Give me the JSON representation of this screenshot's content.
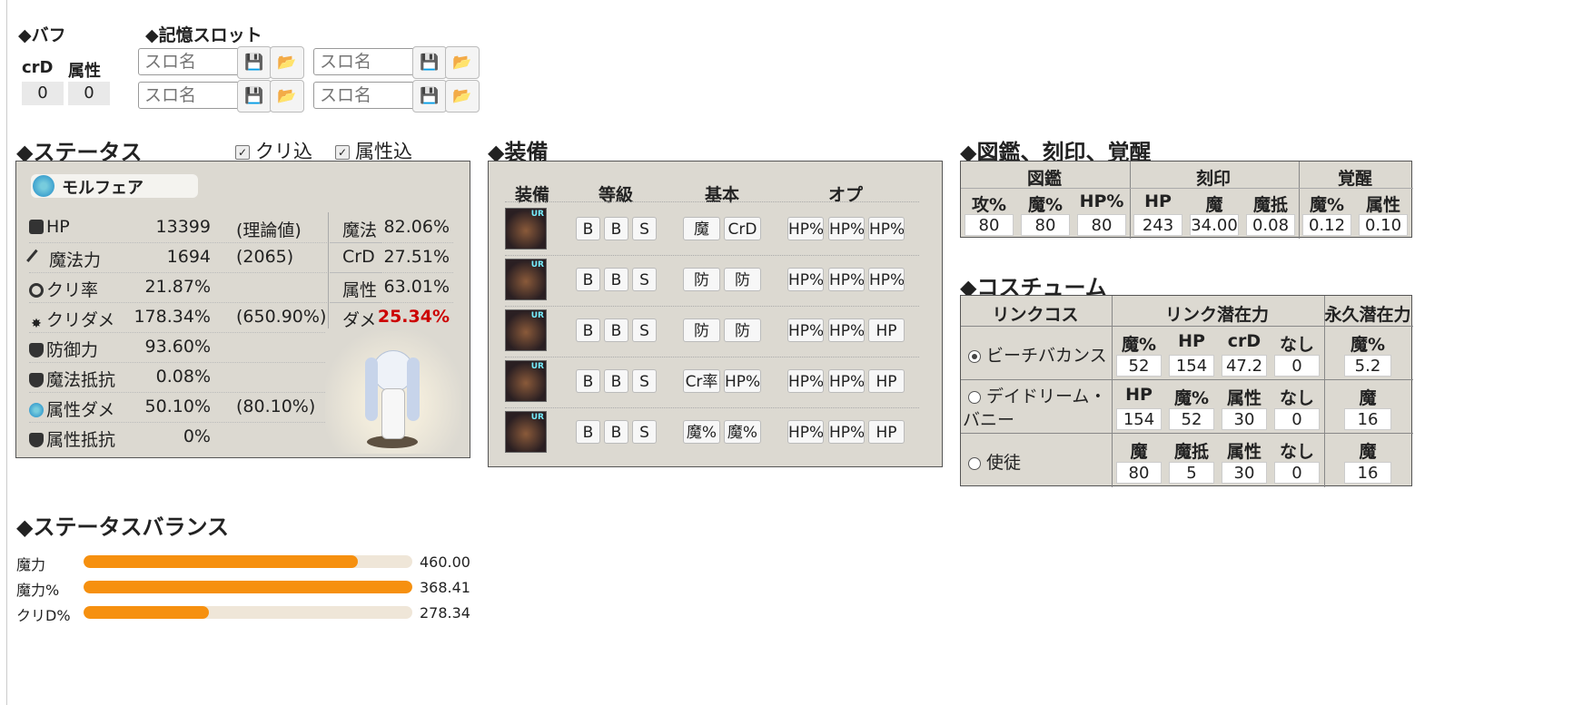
{
  "buff": {
    "title": "◆バフ",
    "crd_label": "crD",
    "attr_label": "属性",
    "crd_value": "0",
    "attr_value": "0"
  },
  "memory": {
    "title": "◆記憶スロット",
    "slot_placeholder": "スロ名"
  },
  "status": {
    "title": "◆ステータス",
    "crit_check": "クリ込",
    "attr_check": "属性込",
    "character_name": "モルフェア",
    "rows": [
      {
        "name": "HP",
        "value": "13399",
        "extra": "(理論値)"
      },
      {
        "name": "魔法力",
        "value": "1694",
        "extra": "(2065)"
      },
      {
        "name": "クリ率",
        "value": "21.87%",
        "extra": ""
      },
      {
        "name": "クリダメ",
        "value": "178.34%",
        "extra": "(650.90%)"
      },
      {
        "name": "防御力",
        "value": "93.60%",
        "extra": ""
      },
      {
        "name": "魔法抵抗",
        "value": "0.08%",
        "extra": ""
      },
      {
        "name": "属性ダメ",
        "value": "50.10%",
        "extra": "(80.10%)"
      },
      {
        "name": "属性抵抗",
        "value": "0%",
        "extra": ""
      }
    ],
    "sub": [
      {
        "key": "魔法",
        "value": "82.06%"
      },
      {
        "key": "CrD",
        "value": "27.51%"
      },
      {
        "key": "属性",
        "value": "63.01%"
      },
      {
        "key": "ダメ",
        "value": "25.34%"
      }
    ],
    "highlight_color": "#cc0000"
  },
  "equipment": {
    "title": "◆装備",
    "headers": [
      "装備",
      "等級",
      "基本",
      "オプ"
    ],
    "rows": [
      {
        "grades": [
          "B",
          "B",
          "S"
        ],
        "basic": [
          "魔",
          "CrD"
        ],
        "opts": [
          "HP%",
          "HP%",
          "HP%"
        ]
      },
      {
        "grades": [
          "B",
          "B",
          "S"
        ],
        "basic": [
          "防",
          "防"
        ],
        "opts": [
          "HP%",
          "HP%",
          "HP%"
        ]
      },
      {
        "grades": [
          "B",
          "B",
          "S"
        ],
        "basic": [
          "防",
          "防"
        ],
        "opts": [
          "HP%",
          "HP%",
          "HP"
        ]
      },
      {
        "grades": [
          "B",
          "B",
          "S"
        ],
        "basic": [
          "Cr率",
          "HP%"
        ],
        "opts": [
          "HP%",
          "HP%",
          "HP"
        ]
      },
      {
        "grades": [
          "B",
          "B",
          "S"
        ],
        "basic": [
          "魔%",
          "魔%"
        ],
        "opts": [
          "HP%",
          "HP%",
          "HP"
        ]
      }
    ],
    "thumb_badge": "UR"
  },
  "collection": {
    "title": "◆図鑑、刻印、覚醒",
    "groups": [
      "図鑑",
      "刻印",
      "覚醒"
    ],
    "headers": [
      "攻%",
      "魔%",
      "HP%",
      "HP",
      "魔",
      "魔抵",
      "魔%",
      "属性"
    ],
    "values": [
      "80",
      "80",
      "80",
      "243",
      "34.00",
      "0.08",
      "0.12",
      "0.10"
    ]
  },
  "costume": {
    "title": "◆コスチューム",
    "headers": [
      "リンクコス",
      "リンク潜在力",
      "永久潜在力"
    ],
    "rows": [
      {
        "name": "ビーチバカンス",
        "selected": true,
        "labels": [
          "魔%",
          "HP",
          "crD",
          "なし"
        ],
        "values": [
          "52",
          "154",
          "47.2",
          "0"
        ],
        "perm_label": "魔%",
        "perm_value": "5.2"
      },
      {
        "name": "デイドリーム・バニー",
        "selected": false,
        "labels": [
          "HP",
          "魔%",
          "属性",
          "なし"
        ],
        "values": [
          "154",
          "52",
          "30",
          "0"
        ],
        "perm_label": "魔",
        "perm_value": "16"
      },
      {
        "name": "使徒",
        "selected": false,
        "labels": [
          "魔",
          "魔抵",
          "属性",
          "なし"
        ],
        "values": [
          "80",
          "5",
          "30",
          "0"
        ],
        "perm_label": "魔",
        "perm_value": "16"
      }
    ]
  },
  "balance": {
    "title": "◆ステータスバランス",
    "bars": [
      {
        "label": "魔力",
        "value": "460.00",
        "fraction": 0.834
      },
      {
        "label": "魔力%",
        "value": "368.41",
        "fraction": 1.0
      },
      {
        "label": "クリD%",
        "value": "278.34",
        "fraction": 0.38
      }
    ],
    "bar_color": "#f6900f",
    "track_color": "#efe6d8"
  }
}
